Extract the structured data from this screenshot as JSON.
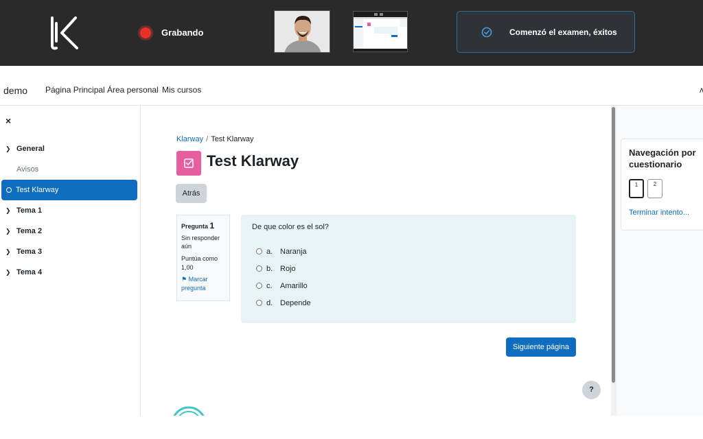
{
  "proctor": {
    "recording_label": "Grabando",
    "status_text": "Comenzó el examen, éxitos",
    "colors": {
      "bar_bg": "#2a2a2a",
      "record_dot": "#e5312b",
      "status_border": "#2f6aa0"
    },
    "icons": [
      "klarway-logo-icon",
      "record-dot-icon",
      "check-circle-icon"
    ]
  },
  "nav": {
    "site_name": "demo",
    "links": [
      "Página Principal",
      "Área personal",
      "Mis cursos"
    ],
    "edge_glyph": "ʌ"
  },
  "sidebar": {
    "close_glyph": "×",
    "sections": [
      {
        "label": "General"
      },
      {
        "label": "Tema 1"
      },
      {
        "label": "Tema 2"
      },
      {
        "label": "Tema 3"
      },
      {
        "label": "Tema 4"
      }
    ],
    "items": [
      {
        "label": "Avisos",
        "active": false
      },
      {
        "label": "Test Klarway",
        "active": true
      }
    ]
  },
  "breadcrumb": {
    "items": [
      "Klarway",
      "Test Klarway"
    ],
    "separator": "/"
  },
  "page": {
    "title": "Test Klarway",
    "back_label": "Atrás",
    "next_label": "Siguiente página",
    "help_label": "?",
    "accent_color": "#0f6cbf",
    "quiz_icon_color": "#e45ea0"
  },
  "question": {
    "label": "Pregunta",
    "number": "1",
    "state": "Sin responder aún",
    "marks": "Puntúa como 1,00",
    "flag_label": "Marcar pregunta",
    "text": "De que color es el sol?",
    "options": [
      {
        "letter": "a.",
        "text": "Naranja"
      },
      {
        "letter": "b.",
        "text": "Rojo"
      },
      {
        "letter": "c.",
        "text": "Amarillo"
      },
      {
        "letter": "d.",
        "text": "Depende"
      }
    ]
  },
  "quiz_nav": {
    "title": "Navegación por cuestionario",
    "questions": [
      "1",
      "2"
    ],
    "current": "1",
    "finish_label": "Terminar intento..."
  }
}
